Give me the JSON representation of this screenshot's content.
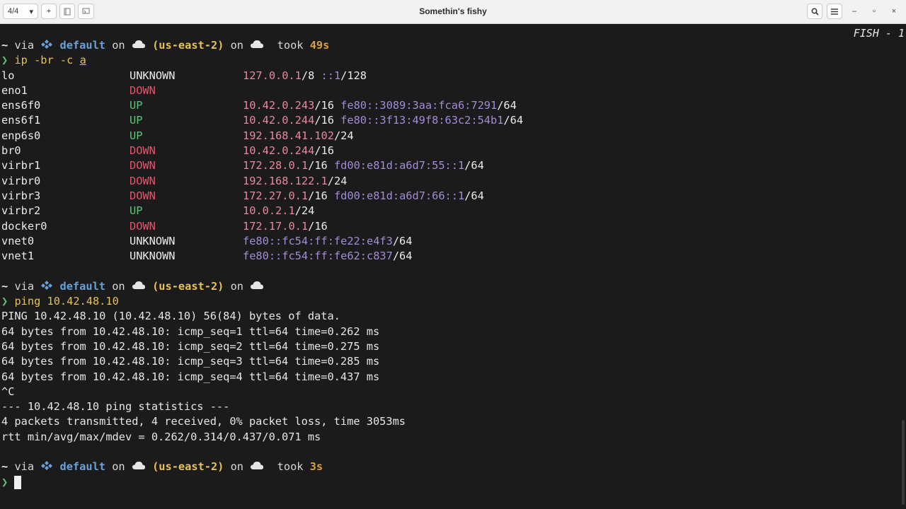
{
  "titlebar": {
    "tab_counter": "4/4",
    "new_tab": "+",
    "title": "Somethin's fishy",
    "search_icon": "search-icon",
    "menu_icon": "menu-icon",
    "minimize": "–",
    "maximize": "▫",
    "close": "×"
  },
  "terminal": {
    "shell_label": "FISH - 1",
    "prompt": {
      "tilde": "~",
      "via": "via",
      "profile": "default",
      "on": "on",
      "region": "(us-east-2)",
      "took": "took",
      "arrow": "❯"
    },
    "block1": {
      "duration": "49s",
      "cmd": "ip",
      "args_a": "-br -c",
      "args_b": "a",
      "interfaces": [
        {
          "name": "lo",
          "state": "UNKNOWN",
          "addr4": "127.0.0.1",
          "mask4": "/8",
          "addr6": "::1",
          "mask6": "/128"
        },
        {
          "name": "eno1",
          "state": "DOWN",
          "addr4": "",
          "mask4": "",
          "addr6": "",
          "mask6": ""
        },
        {
          "name": "ens6f0",
          "state": "UP",
          "addr4": "10.42.0.243",
          "mask4": "/16",
          "addr6": "fe80::3089:3aa:fca6:7291",
          "mask6": "/64"
        },
        {
          "name": "ens6f1",
          "state": "UP",
          "addr4": "10.42.0.244",
          "mask4": "/16",
          "addr6": "fe80::3f13:49f8:63c2:54b1",
          "mask6": "/64"
        },
        {
          "name": "enp6s0",
          "state": "UP",
          "addr4": "192.168.41.102",
          "mask4": "/24",
          "addr6": "",
          "mask6": ""
        },
        {
          "name": "br0",
          "state": "DOWN",
          "addr4": "10.42.0.244",
          "mask4": "/16",
          "addr6": "",
          "mask6": ""
        },
        {
          "name": "virbr1",
          "state": "DOWN",
          "addr4": "172.28.0.1",
          "mask4": "/16",
          "addr6": "fd00:e81d:a6d7:55::1",
          "mask6": "/64"
        },
        {
          "name": "virbr0",
          "state": "DOWN",
          "addr4": "192.168.122.1",
          "mask4": "/24",
          "addr6": "",
          "mask6": ""
        },
        {
          "name": "virbr3",
          "state": "DOWN",
          "addr4": "172.27.0.1",
          "mask4": "/16",
          "addr6": "fd00:e81d:a6d7:66::1",
          "mask6": "/64"
        },
        {
          "name": "virbr2",
          "state": "UP",
          "addr4": "10.0.2.1",
          "mask4": "/24",
          "addr6": "",
          "mask6": ""
        },
        {
          "name": "docker0",
          "state": "DOWN",
          "addr4": "172.17.0.1",
          "mask4": "/16",
          "addr6": "",
          "mask6": ""
        },
        {
          "name": "vnet0",
          "state": "UNKNOWN",
          "addr4": "",
          "mask4": "",
          "addr6": "fe80::fc54:ff:fe22:e4f3",
          "mask6": "/64"
        },
        {
          "name": "vnet1",
          "state": "UNKNOWN",
          "addr4": "",
          "mask4": "",
          "addr6": "fe80::fc54:ff:fe62:c837",
          "mask6": "/64"
        }
      ]
    },
    "block2": {
      "cmd": "ping",
      "args": "10.42.48.10",
      "output": [
        "PING 10.42.48.10 (10.42.48.10) 56(84) bytes of data.",
        "64 bytes from 10.42.48.10: icmp_seq=1 ttl=64 time=0.262 ms",
        "64 bytes from 10.42.48.10: icmp_seq=2 ttl=64 time=0.275 ms",
        "64 bytes from 10.42.48.10: icmp_seq=3 ttl=64 time=0.285 ms",
        "64 bytes from 10.42.48.10: icmp_seq=4 ttl=64 time=0.437 ms",
        "^C",
        "--- 10.42.48.10 ping statistics ---",
        "4 packets transmitted, 4 received, 0% packet loss, time 3053ms",
        "rtt min/avg/max/mdev = 0.262/0.314/0.437/0.071 ms"
      ]
    },
    "block3": {
      "duration": "3s"
    }
  }
}
